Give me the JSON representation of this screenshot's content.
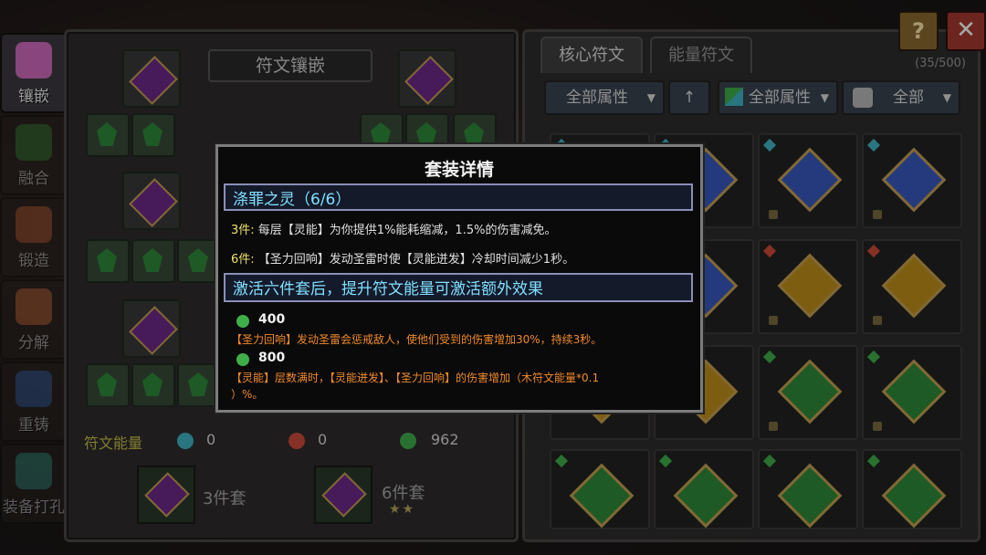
{
  "nav": {
    "items": [
      {
        "label": "镶嵌",
        "icon": "inlay-icon",
        "color": "#d36cc0"
      },
      {
        "label": "融合",
        "icon": "fuse-icon",
        "color": "#3c8a3c"
      },
      {
        "label": "锻造",
        "icon": "forge-icon",
        "color": "#c0603a"
      },
      {
        "label": "分解",
        "icon": "decompose-icon",
        "color": "#d07040"
      },
      {
        "label": "重铸",
        "icon": "recast-icon",
        "color": "#3c6ab0"
      },
      {
        "label": "装备打孔",
        "icon": "drill-icon",
        "color": "#3c9a8a"
      }
    ]
  },
  "left": {
    "title": "符文镶嵌",
    "energy_label": "符文能量",
    "energies": [
      {
        "icon": "water-rune-icon",
        "color": "#3fb6c6",
        "value": "0"
      },
      {
        "icon": "fire-rune-icon",
        "color": "#d04a3a",
        "value": "0"
      },
      {
        "icon": "wood-rune-icon",
        "color": "#3fae4a",
        "value": "962"
      }
    ],
    "sets": [
      {
        "label": "3件套",
        "stars": ""
      },
      {
        "label": "6件套",
        "stars": "★★"
      }
    ]
  },
  "right": {
    "tabs": [
      "核心符文",
      "能量符文"
    ],
    "count": "(35/500)",
    "filters": [
      {
        "label": "全部属性",
        "caret": "▼"
      },
      {
        "label": "↑",
        "caret": ""
      },
      {
        "label": "全部属性",
        "caret": "▼"
      },
      {
        "label": "全部",
        "caret": "▼"
      }
    ]
  },
  "buttons": {
    "help": "?",
    "close": "✕"
  },
  "modal": {
    "title": "套装详情",
    "set_name": "涤罪之灵（6/6）",
    "bonus3_prefix": "3件:",
    "bonus3_text": "每层【灵能】为你提供1%能耗缩减，1.5%的伤害减免。",
    "bonus6_prefix": "6件:",
    "bonus6_text": "【圣力回响】发动圣雷时使【灵能迸发】冷却时间减少1秒。",
    "extra_header": "激活六件套后，提升符文能量可激活额外效果",
    "tiers": [
      {
        "energy": "400",
        "text": "【圣力回响】发动圣雷会惩戒敌人，使他们受到的伤害增加30%，持续3秒。"
      },
      {
        "energy": "800",
        "text": "【灵能】层数满时，【灵能迸发】、【圣力回响】的伤害增加（木符文能量*0.1",
        "text2": "）%。"
      }
    ]
  },
  "colors": {
    "wood_rune": "#3fae4a",
    "accent_cyan": "#7fe0ff",
    "orange_text": "#f08a2a"
  }
}
